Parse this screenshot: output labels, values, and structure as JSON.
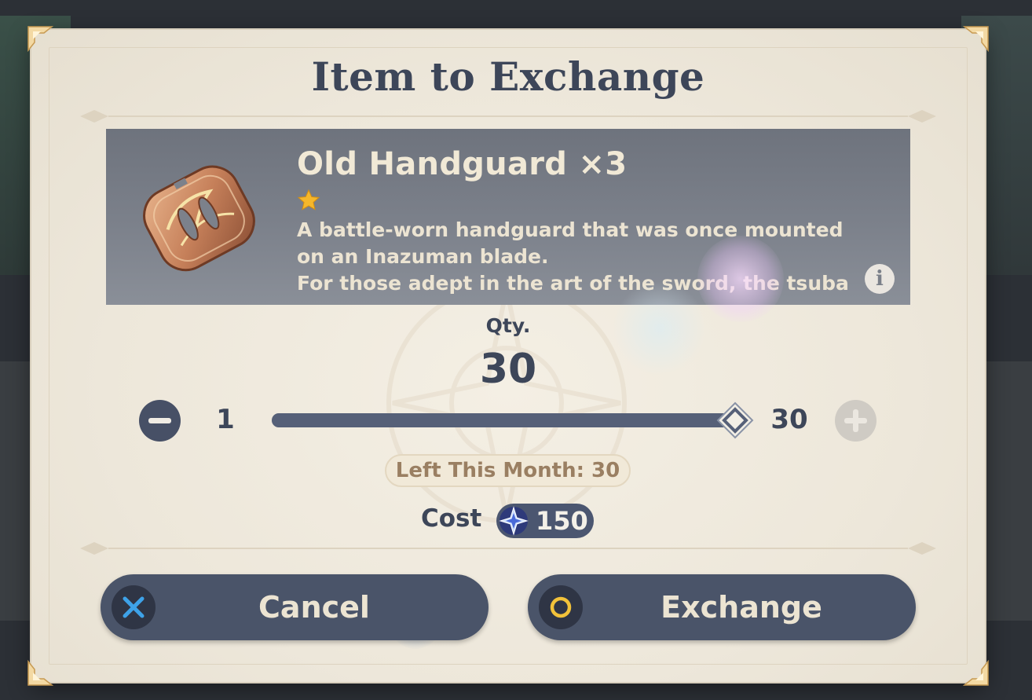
{
  "dialog": {
    "title": "Item to Exchange"
  },
  "item": {
    "name": "Old Handguard ×3",
    "rarity_stars": 1,
    "icon": "handguard-tsuba-icon",
    "description_lines": [
      "A battle-worn handguard that was once mounted",
      "on an Inazuman blade.",
      "For those adept in the art of the sword, the tsuba"
    ],
    "info_icon": "i"
  },
  "quantity": {
    "label": "Qty.",
    "value": "30",
    "min_label": "1",
    "max_label": "30",
    "min": 1,
    "max": 30,
    "current": 30
  },
  "limit": {
    "text": "Left This Month: 30"
  },
  "cost": {
    "label": "Cost",
    "value": "150",
    "currency_icon": "stardust-icon"
  },
  "buttons": {
    "cancel_label": "Cancel",
    "cancel_icon": "cross-icon",
    "exchange_label": "Exchange",
    "exchange_icon": "circle-icon"
  },
  "colors": {
    "title": "#3d4659",
    "button_bg": "#4a5469",
    "cancel_icon": "#3ea2e8",
    "exchange_icon": "#f2c23a",
    "star": "#f5b72b",
    "slider_fill": "#566078",
    "panel_bg": "#7c818b"
  }
}
